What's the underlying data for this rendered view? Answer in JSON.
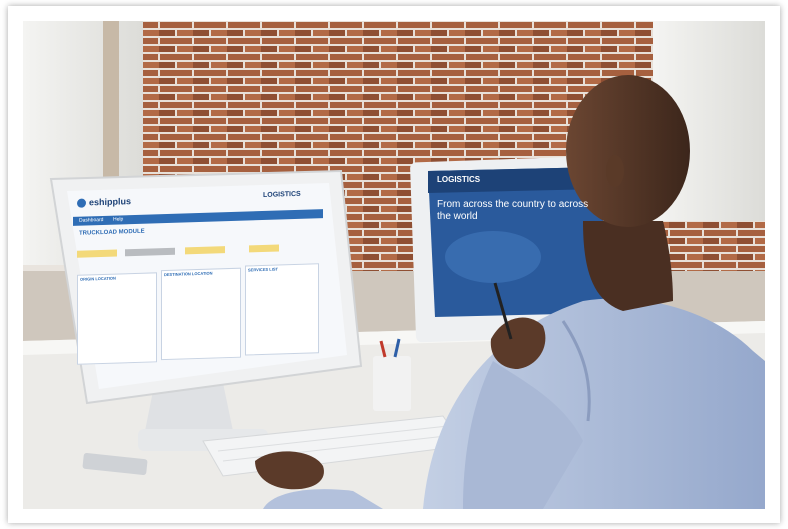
{
  "left_monitor": {
    "logo_text": "eshipplus",
    "partner_logo": "LOGISTICS",
    "module_title": "TRUCKLOAD MODULE",
    "bookmark_label": "Dashboard",
    "help_label": "Help",
    "panel_origin": "ORIGIN LOCATION",
    "panel_destination": "DESTINATION LOCATION",
    "panel_services": "SERVICES LIST"
  },
  "right_monitor": {
    "partner_logo": "LOGISTICS",
    "headline": "From across the country to across the world"
  },
  "colors": {
    "accent_blue": "#2f6db5",
    "screen_blue": "#2a5a9c",
    "wall_brick": "#9a5a3c",
    "shirt": "#aab9d6"
  }
}
